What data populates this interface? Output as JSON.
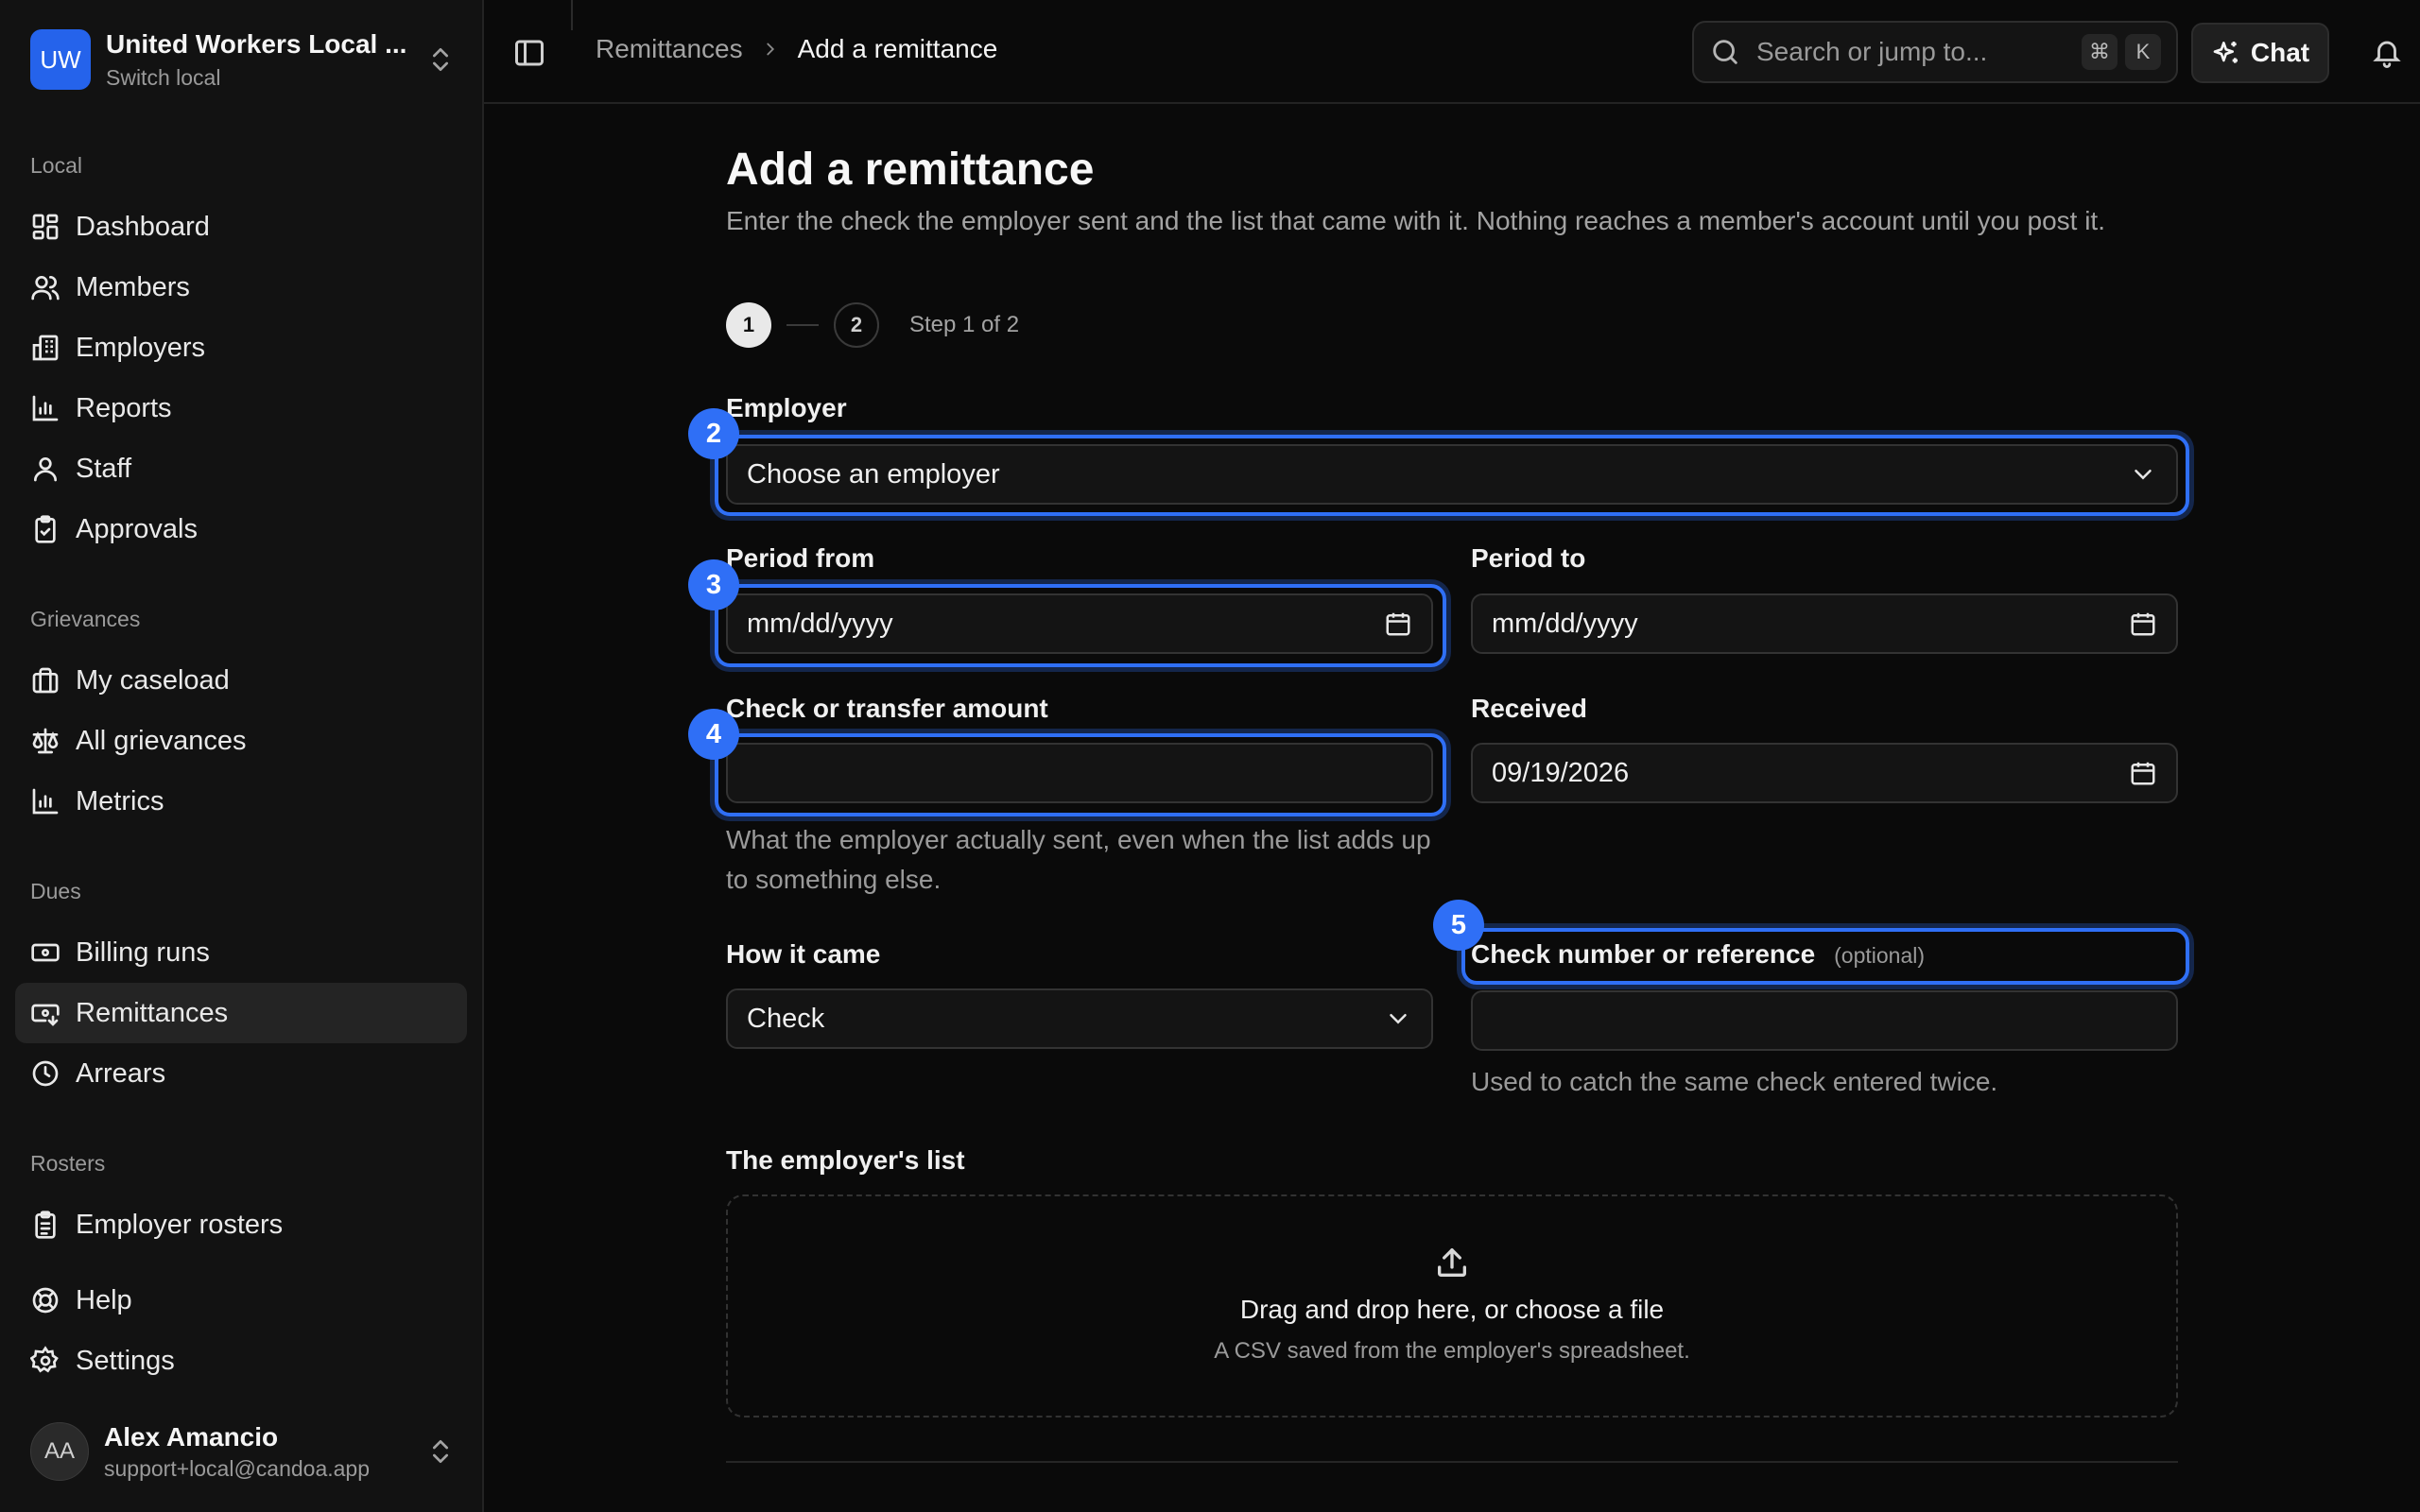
{
  "org": {
    "initials": "UW",
    "name": "United Workers Local ...",
    "subtitle": "Switch local"
  },
  "sidebar": {
    "groups": {
      "local": "Local",
      "grievances": "Grievances",
      "dues": "Dues",
      "rosters": "Rosters"
    },
    "items": {
      "dashboard": "Dashboard",
      "members": "Members",
      "employers": "Employers",
      "reports": "Reports",
      "staff": "Staff",
      "approvals": "Approvals",
      "my_caseload": "My caseload",
      "all_grievances": "All grievances",
      "metrics": "Metrics",
      "billing_runs": "Billing runs",
      "remittances": "Remittances",
      "arrears": "Arrears",
      "employer_rosters": "Employer rosters",
      "help": "Help",
      "settings": "Settings"
    }
  },
  "user": {
    "initials": "AA",
    "name": "Alex Amancio",
    "email": "support+local@candoa.app"
  },
  "topbar": {
    "breadcrumb": {
      "parent": "Remittances",
      "current": "Add a remittance"
    },
    "search_placeholder": "Search or jump to...",
    "shortcut": {
      "mod": "⌘",
      "key": "K"
    },
    "chat_label": "Chat"
  },
  "page": {
    "title": "Add a remittance",
    "description": "Enter the check the employer sent and the list that came with it. Nothing reaches a member's account until you post it."
  },
  "stepper": {
    "step1": "1",
    "step2": "2",
    "text": "Step 1 of 2"
  },
  "form": {
    "employer": {
      "label": "Employer",
      "value": "Choose an employer"
    },
    "period_from": {
      "label": "Period from",
      "value": "mm/dd/yyyy"
    },
    "period_to": {
      "label": "Period to",
      "value": "mm/dd/yyyy"
    },
    "amount": {
      "label": "Check or transfer amount",
      "value": "",
      "help": "What the employer actually sent, even when the list adds up to something else."
    },
    "received": {
      "label": "Received",
      "value": "09/19/2026"
    },
    "method": {
      "label": "How it came",
      "value": "Check"
    },
    "reference": {
      "label": "Check number or reference",
      "optional": "(optional)",
      "value": "",
      "help": "Used to catch the same check entered twice."
    },
    "list": {
      "label": "The employer's list",
      "drop_title": "Drag and drop here, or choose a file",
      "drop_sub": "A CSV saved from the employer's spreadsheet."
    }
  },
  "badges": {
    "b2": "2",
    "b3": "3",
    "b4": "4",
    "b5": "5"
  },
  "colors": {
    "accent": "#2f6ff6",
    "brand": "#2563eb",
    "background": "#0a0a0a"
  }
}
